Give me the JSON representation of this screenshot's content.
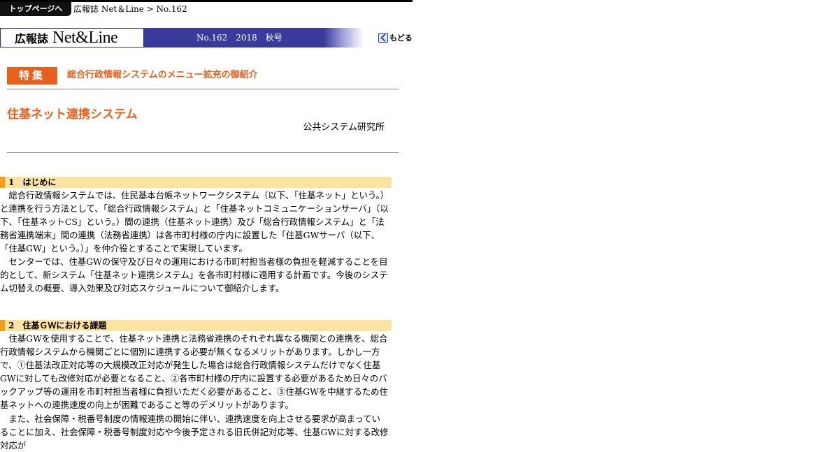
{
  "nav": {
    "top_button": "トップページへ",
    "breadcrumb": "広報誌 Net＆Line > No.162"
  },
  "masthead": {
    "logo_ja": "広報誌",
    "logo_en": "Net&Line",
    "issue": "No.162　2018　秋号",
    "back_label": "もどる"
  },
  "feature": {
    "tag": "特集",
    "title": "総合行政情報システムのメニュー拡充の御紹介"
  },
  "article": {
    "title": "住基ネット連携システム",
    "author": "公共システム研究所"
  },
  "sections": [
    {
      "heading_num": "1",
      "heading": "はじめに",
      "paragraphs": [
        "総合行政情報システムでは、住民基本台帳ネットワークシステム（以下、「住基ネット」という。）と連携を行う方法として、「総合行政情報システム」と「住基ネットコミュニケーションサーバ」（以下、「住基ネットCS」という。）間の連携（住基ネット連携）及び「総合行政情報システム」と「法務省連携端末」間の連携（法務省連携）は各市町村様の庁内に設置した「住基GWサーバ（以下、「住基GW」という。）」を仲介役とすることで実現しています。",
        "センターでは、住基GWの保守及び日々の運用における市町村担当者様の負担を軽減することを目的として、新システム「住基ネット連携システム」を各市町村様に適用する計画です。今後のシステム切替えの概要、導入効果及び対応スケジュールについて御紹介します。"
      ]
    },
    {
      "heading_num": "2",
      "heading": "住基ＧＷにおける課題",
      "paragraphs": [
        "住基GWを使用することで、住基ネット連携と法務省連携のそれぞれ異なる機関との連携を、総合行政情報システムから機関ごとに個別に連携する必要が無くなるメリットがあります。しかし一方で、①住基法改正対応等の大規模改正対応が発生した場合は総合行政情報システムだけでなく住基GWに対しても改修対応が必要となること、②各市町村様の庁内に設置する必要があるため日々のバックアップ等の運用を市町村担当者様に負担いただく必要があること、③住基GWを中継するため住基ネットへの連携速度の向上が困難であること等のデメリットがあります。",
        "また、社会保障・税番号制度の情報連携の開始に伴い、連携速度を向上させる要求が高まっていることに加え、社会保障・税番号制度対応や今後予定される旧氏併記対応等、住基GWに対する改修対応が"
      ]
    }
  ],
  "colors": {
    "accent_orange": "#e8601c",
    "issue_bar": "#3a3a9a",
    "section_bg": "#fde3a0",
    "section_mark": "#f0a020"
  }
}
